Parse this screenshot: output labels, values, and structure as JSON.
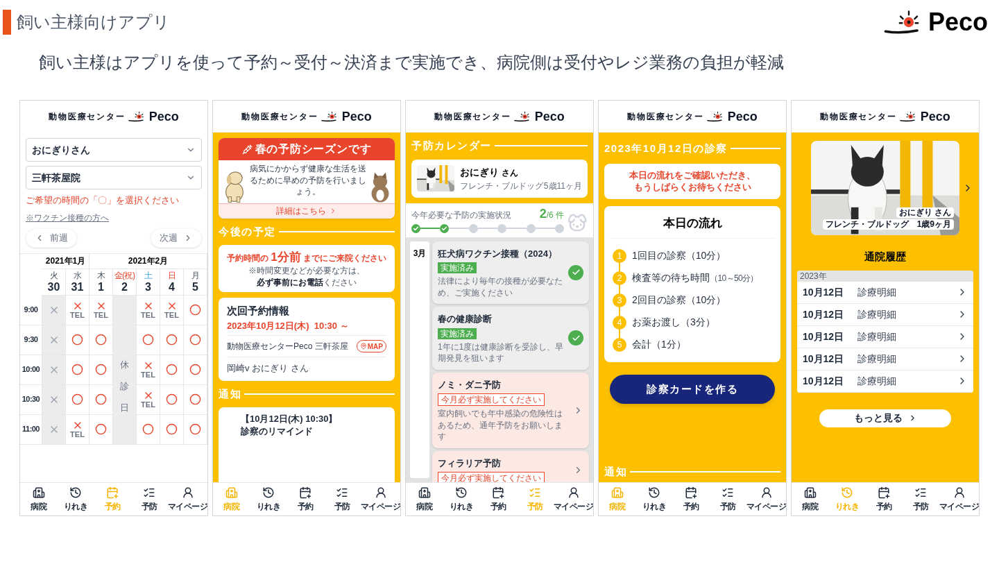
{
  "slide": {
    "section_title": "飼い主様向けアプリ",
    "brand": "Peco",
    "headline": "飼い主様はアプリを使って予約～受付～決済まで実施でき、病院側は受付やレジ業務の負担が軽減"
  },
  "phones": [
    {
      "kind": "booking",
      "header": {
        "clinic": "動物医療センター",
        "brand": "Peco"
      },
      "selects": [
        {
          "value": "おにぎりさん"
        },
        {
          "value": "三軒茶屋院"
        }
      ],
      "instruction": "ご希望の時間の「〇」を選択ください",
      "link": "※ワクチン接種の方へ",
      "prev": "前週",
      "next": "次週",
      "months": [
        {
          "label": "2021年1月",
          "days": [
            {
              "weekday": "火",
              "date": "30",
              "kind": "past"
            },
            {
              "weekday": "水",
              "date": "31",
              "kind": "weekday"
            }
          ]
        },
        {
          "label": "2021年2月",
          "days": [
            {
              "weekday": "木",
              "date": "1",
              "kind": "weekday"
            },
            {
              "weekday": "金(祝)",
              "date": "2",
              "kind": "holiday",
              "closed_label": "休診日"
            },
            {
              "weekday": "土",
              "date": "3",
              "kind": "saturday"
            },
            {
              "weekday": "日",
              "date": "4",
              "kind": "sunday"
            },
            {
              "weekday": "月",
              "date": "5",
              "kind": "weekday"
            }
          ]
        }
      ],
      "rows": [
        {
          "time": "9:00",
          "slots": [
            {
              "kind": "past"
            },
            {
              "kind": "tel",
              "label": "TEL"
            },
            {
              "kind": "tel",
              "label": "TEL"
            },
            {
              "kind": "closed"
            },
            {
              "kind": "tel",
              "label": "TEL"
            },
            {
              "kind": "tel",
              "label": "TEL"
            },
            {
              "kind": "open"
            }
          ]
        },
        {
          "time": "9:30",
          "slots": [
            {
              "kind": "past"
            },
            {
              "kind": "open"
            },
            {
              "kind": "open"
            },
            {
              "kind": "closed"
            },
            {
              "kind": "open"
            },
            {
              "kind": "open"
            },
            {
              "kind": "open"
            }
          ]
        },
        {
          "time": "10:00",
          "slots": [
            {
              "kind": "past"
            },
            {
              "kind": "open"
            },
            {
              "kind": "open"
            },
            {
              "kind": "closed"
            },
            {
              "kind": "tel",
              "label": "TEL"
            },
            {
              "kind": "open"
            },
            {
              "kind": "open"
            }
          ]
        },
        {
          "time": "10:30",
          "slots": [
            {
              "kind": "past"
            },
            {
              "kind": "open"
            },
            {
              "kind": "open"
            },
            {
              "kind": "closed"
            },
            {
              "kind": "tel",
              "label": "TEL"
            },
            {
              "kind": "open"
            },
            {
              "kind": "open"
            }
          ]
        },
        {
          "time": "11:00",
          "slots": [
            {
              "kind": "past"
            },
            {
              "kind": "tel",
              "label": "TEL"
            },
            {
              "kind": "open"
            },
            {
              "kind": "closed"
            },
            {
              "kind": "open"
            },
            {
              "kind": "open"
            },
            {
              "kind": "open"
            }
          ]
        }
      ],
      "nav": [
        {
          "label": "病院",
          "selected": false
        },
        {
          "label": "りれき",
          "selected": false
        },
        {
          "label": "予約",
          "selected": true
        },
        {
          "label": "予防",
          "selected": false
        },
        {
          "label": "マイページ",
          "selected": false
        }
      ]
    },
    {
      "kind": "home",
      "header": {
        "clinic": "動物医療センター",
        "brand": "Peco"
      },
      "banner": {
        "title": "春の予防シーズンです",
        "body": "病気にかからず健康な生活を送るために早めの予防を行いましょう。",
        "link": "詳細はこちら"
      },
      "upcoming_heading": "今後の予定",
      "notice": [
        "予約時間の **1分前** までにご来院ください",
        "※時間変更などが必要な方は、",
        "**必ず事前にお電話**ください"
      ],
      "next": {
        "title": "次回予約情報",
        "datetime": "2023年10月12日(木)  10:30 ～",
        "clinic": "動物医療センターPeco 三軒茶屋",
        "map": "MAP",
        "pet": "岡崎v おにぎり さん"
      },
      "notice_heading": "通知",
      "notification": [
        "【10月12日(木) 10:30】",
        "診察のリマインド"
      ],
      "nav": [
        {
          "label": "病院",
          "selected": true
        },
        {
          "label": "りれき",
          "selected": false
        },
        {
          "label": "予約",
          "selected": false
        },
        {
          "label": "予防",
          "selected": false
        },
        {
          "label": "マイページ",
          "selected": false
        }
      ]
    },
    {
      "kind": "prevention",
      "header": {
        "clinic": "動物医療センター",
        "brand": "Peco"
      },
      "heading": "予防カレンダー",
      "pet": {
        "name": "おにぎり",
        "suffix": "さん",
        "breed": "フレンチ・ブルドッグ",
        "age": "5歳11ヶ月"
      },
      "progress": {
        "label": "今年必要な予防の実施状況",
        "done": "2",
        "total": "/6 件",
        "steps": [
          {
            "done": true
          },
          {
            "done": true
          },
          {
            "done": false
          },
          {
            "done": false
          },
          {
            "done": false
          },
          {
            "done": false
          }
        ]
      },
      "month": "3月",
      "items": [
        {
          "kind": "done",
          "title": "狂犬病ワクチン接種（2024）",
          "badge": "実施済み",
          "desc": "法律により毎年の接種が必要なため、ご実施ください"
        },
        {
          "kind": "done",
          "title": "春の健康診断",
          "badge": "実施済み",
          "desc": "1年に1度は健康診断を受診し、早期発見を狙います"
        },
        {
          "kind": "due",
          "title": "ノミ・ダニ予防",
          "badge": "今月必ず実施してください",
          "desc": "室内飼いでも年中感染の危険性はあるため、通年予防をお願いします"
        },
        {
          "kind": "due",
          "title": "フィラリア予防",
          "badge": "今月必ず実施してください"
        }
      ],
      "nav": [
        {
          "label": "病院",
          "selected": false
        },
        {
          "label": "りれき",
          "selected": false
        },
        {
          "label": "予約",
          "selected": false
        },
        {
          "label": "予防",
          "selected": true
        },
        {
          "label": "マイページ",
          "selected": false
        }
      ]
    },
    {
      "kind": "visit",
      "header": {
        "clinic": "動物医療センター",
        "brand": "Peco"
      },
      "heading": "2023年10月12日の診察",
      "notice": [
        "本日の流れをご確認いただき、",
        "もうしばらくお待ちください"
      ],
      "flow": {
        "title": "本日の流れ",
        "steps": [
          {
            "number": "1",
            "label": "1回目の診察（10分）"
          },
          {
            "number": "2",
            "label": "検査等の待ち時間",
            "note": "（10～50分）"
          },
          {
            "number": "3",
            "label": "2回目の診察（10分）"
          },
          {
            "number": "4",
            "label": "お薬お渡し（3分）"
          },
          {
            "number": "5",
            "label": "会計（1分）"
          }
        ]
      },
      "button": "診察カードを作る",
      "notice_heading": "通知",
      "nav": [
        {
          "label": "病院",
          "selected": true
        },
        {
          "label": "りれき",
          "selected": false
        },
        {
          "label": "予約",
          "selected": false
        },
        {
          "label": "予防",
          "selected": false
        },
        {
          "label": "マイページ",
          "selected": false
        }
      ]
    },
    {
      "kind": "history",
      "header": {
        "clinic": "動物医療センター",
        "brand": "Peco"
      },
      "photo": {
        "name": "おにぎり さん",
        "detail": "フレンチ・ブルドッグ　1歳9ヶ月"
      },
      "heading": "通院履歴",
      "year": "2023年",
      "records": [
        {
          "date": "10月12日",
          "label": "診療明細"
        },
        {
          "date": "10月12日",
          "label": "診療明細"
        },
        {
          "date": "10月12日",
          "label": "診療明細"
        },
        {
          "date": "10月12日",
          "label": "診療明細"
        },
        {
          "date": "10月12日",
          "label": "診療明細"
        }
      ],
      "more": "もっと見る",
      "nav": [
        {
          "label": "病院",
          "selected": false
        },
        {
          "label": "りれき",
          "selected": true
        },
        {
          "label": "予約",
          "selected": false
        },
        {
          "label": "予防",
          "selected": false
        },
        {
          "label": "マイページ",
          "selected": false
        }
      ]
    }
  ]
}
